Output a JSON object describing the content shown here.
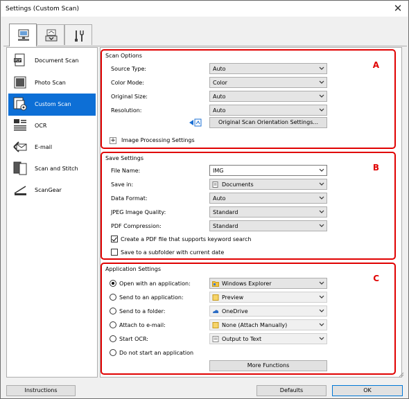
{
  "window": {
    "title": "Settings (Custom Scan)",
    "close": "✕"
  },
  "tabs": [
    {
      "name": "scan-from-computer"
    },
    {
      "name": "scan-from-operation-panel"
    },
    {
      "name": "general-settings"
    }
  ],
  "left_list": [
    {
      "label": "Document Scan",
      "icon": "document-scan-icon"
    },
    {
      "label": "Photo Scan",
      "icon": "photo-scan-icon"
    },
    {
      "label": "Custom Scan",
      "icon": "custom-scan-icon",
      "selected": true
    },
    {
      "label": "OCR",
      "icon": "ocr-icon"
    },
    {
      "label": "E-mail",
      "icon": "email-icon"
    },
    {
      "label": "Scan and Stitch",
      "icon": "scan-and-stitch-icon"
    },
    {
      "label": "ScanGear",
      "icon": "scangear-icon"
    }
  ],
  "scan_options": {
    "heading": "Scan Options",
    "letter": "A",
    "rows": [
      {
        "label": "Source Type:",
        "value": "Auto"
      },
      {
        "label": "Color Mode:",
        "value": "Color"
      },
      {
        "label": "Original Size:",
        "value": "Auto"
      },
      {
        "label": "Resolution:",
        "value": "Auto"
      }
    ],
    "orientation_button": "Original Scan Orientation Settings...",
    "image_processing": "Image Processing Settings",
    "expand_symbol": "+"
  },
  "save_settings": {
    "heading": "Save Settings",
    "letter": "B",
    "rows": [
      {
        "label": "File Name:",
        "value": "IMG"
      },
      {
        "label": "Save in:",
        "value": "Documents"
      },
      {
        "label": "Data Format:",
        "value": "Auto"
      },
      {
        "label": "JPEG Image Quality:",
        "value": "Standard"
      },
      {
        "label": "PDF Compression:",
        "value": "Standard"
      }
    ],
    "checkboxes": [
      {
        "label": "Create a PDF file that supports keyword search",
        "checked": true
      },
      {
        "label": "Save to a subfolder with current date",
        "checked": false
      }
    ]
  },
  "application_settings": {
    "heading": "Application Settings",
    "letter": "C",
    "rows": [
      {
        "label": "Open with an application:",
        "value": "Windows Explorer",
        "selected": true,
        "enabled": true
      },
      {
        "label": "Send to an application:",
        "value": "Preview",
        "selected": false,
        "enabled": false
      },
      {
        "label": "Send to a folder:",
        "value": "OneDrive",
        "selected": false,
        "enabled": false
      },
      {
        "label": "Attach to e-mail:",
        "value": "None (Attach Manually)",
        "selected": false,
        "enabled": false
      },
      {
        "label": "Start OCR:",
        "value": "Output to Text",
        "selected": false,
        "enabled": false
      },
      {
        "label": "Do not start an application",
        "selected": false
      }
    ],
    "more_functions": "More Functions"
  },
  "bottom": {
    "instructions": "Instructions",
    "defaults": "Defaults",
    "ok": "OK"
  },
  "colors": {
    "highlight": "#e00000",
    "selection": "#0d6fd6",
    "window_bg": "#f0f0f0"
  }
}
